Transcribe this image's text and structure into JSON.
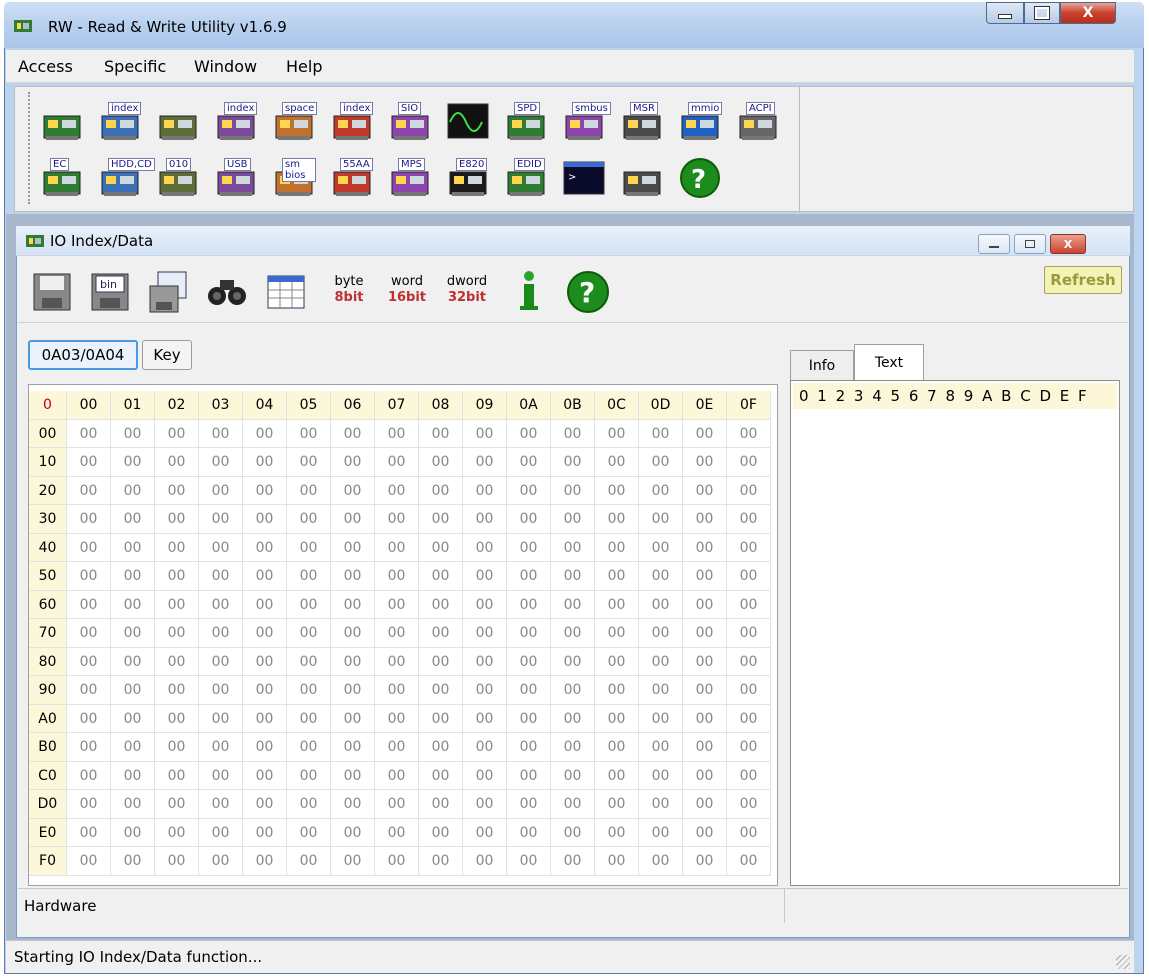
{
  "window": {
    "title": "RW - Read & Write Utility v1.6.9",
    "minimize": "—",
    "maximize": "▢",
    "close": "X"
  },
  "menu": [
    {
      "label": "Access"
    },
    {
      "label": "Specific"
    },
    {
      "label": "Window"
    },
    {
      "label": "Help"
    }
  ],
  "toolbar_row1": [
    {
      "name": "pci",
      "label": ""
    },
    {
      "name": "pci-index",
      "label": "index"
    },
    {
      "name": "memory",
      "label": ""
    },
    {
      "name": "memory-index",
      "label": "index"
    },
    {
      "name": "io-space",
      "label": "space"
    },
    {
      "name": "io-index",
      "label": "index"
    },
    {
      "name": "sio",
      "label": "SIO"
    },
    {
      "name": "waveform",
      "label": ""
    },
    {
      "name": "spd",
      "label": "SPD"
    },
    {
      "name": "smbus",
      "label": "smbus"
    },
    {
      "name": "msr",
      "label": "MSR"
    },
    {
      "name": "mmio",
      "label": "mmio"
    },
    {
      "name": "acpi",
      "label": "ACPI"
    }
  ],
  "toolbar_row2": [
    {
      "name": "ec",
      "label": "EC"
    },
    {
      "name": "hdd-cd",
      "label": "HDD,CD"
    },
    {
      "name": "disk-010",
      "label": "010"
    },
    {
      "name": "usb",
      "label": "USB"
    },
    {
      "name": "smbios",
      "label": "sm bios"
    },
    {
      "name": "55aa",
      "label": "55AA"
    },
    {
      "name": "mps",
      "label": "MPS"
    },
    {
      "name": "e820",
      "label": "E820"
    },
    {
      "name": "edid",
      "label": "EDID"
    },
    {
      "name": "command-window",
      "label": ""
    },
    {
      "name": "hardware",
      "label": ""
    },
    {
      "name": "help",
      "label": "?"
    }
  ],
  "child": {
    "title": "IO Index/Data",
    "refresh_label": "Refresh",
    "bit_buttons": [
      {
        "top": "byte",
        "bottom": "8bit"
      },
      {
        "top": "word",
        "bottom": "16bit"
      },
      {
        "top": "dword",
        "bottom": "32bit"
      }
    ],
    "address_label": "0A03/0A04",
    "key_label": "Key",
    "corner": "0",
    "col_headers": [
      "00",
      "01",
      "02",
      "03",
      "04",
      "05",
      "06",
      "07",
      "08",
      "09",
      "0A",
      "0B",
      "0C",
      "0D",
      "0E",
      "0F"
    ],
    "row_headers": [
      "00",
      "10",
      "20",
      "30",
      "40",
      "50",
      "60",
      "70",
      "80",
      "90",
      "A0",
      "B0",
      "C0",
      "D0",
      "E0",
      "F0"
    ],
    "cell_value": "00",
    "tabs": [
      {
        "label": "Info"
      },
      {
        "label": "Text"
      }
    ],
    "text_header": "0 1 2 3 4 5 6 7 8 9 A B C D E F",
    "hardware_label": "Hardware"
  },
  "status": {
    "text": "Starting IO Index/Data function..."
  }
}
